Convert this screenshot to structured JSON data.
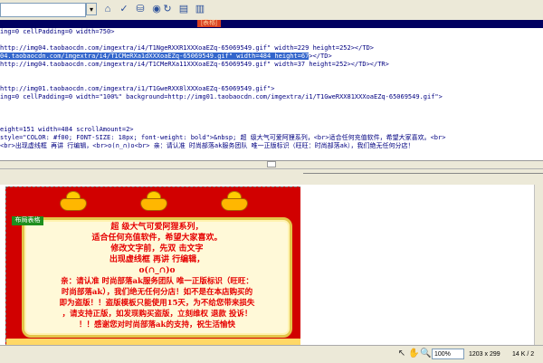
{
  "toolbar": {
    "icons": [
      "validate-icon",
      "check-icon",
      "browser-icon",
      "refresh-icon",
      "options-icon",
      "view-icon"
    ],
    "glyphs": [
      "⌂",
      "✓",
      "⛁",
      "◉",
      "↻",
      "▤",
      "▥"
    ]
  },
  "title_tab": "[表格]",
  "code_lines": [
    {
      "pre": "ing=0 cellPadding=0 width=750>",
      "hl": "",
      "post": ""
    },
    {
      "pre": "",
      "hl": "",
      "post": ""
    },
    {
      "pre": "http://img04.taobaocdn.com/imgextra/i4/T1NgeRXXR1XXXoaEZq-65069549.gif\" width=229 height=252></TD>",
      "hl": "",
      "post": ""
    },
    {
      "pre": "04.taobaocdn.com/imgextra/i4/T1CMeRXa1dXXXoaEZq-65069549.gif\" width=484 height=67",
      "hl": "></TD>",
      "post": ""
    },
    {
      "pre": "http://img04.taobaocdn.com/imgextra/i4/T1CMeRXa11XXXoaEZq-65069549.gif\" width=37 height=252></TD></TR>",
      "hl": "",
      "post": ""
    },
    {
      "pre": "",
      "hl": "",
      "post": ""
    },
    {
      "pre": "",
      "hl": "",
      "post": ""
    },
    {
      "pre": "http://img01.taobaocdn.com/imgextra/i1/T1GweRXX8lXXXoaEZq-65069549.gif\">",
      "hl": "",
      "post": ""
    },
    {
      "pre": "ing=0 cellPadding=0 width=\"100%\" background=http://img01.taobaocdn.com/imgextra/i1/T1GweRXX81XXXoaEZq-65069549.gif\">",
      "hl": "",
      "post": ""
    },
    {
      "pre": "",
      "hl": "",
      "post": ""
    },
    {
      "pre": "",
      "hl": "",
      "post": ""
    },
    {
      "pre": "",
      "hl": "",
      "post": ""
    },
    {
      "pre": "eight=151 width=484 scrollAmount=2>",
      "hl": "",
      "post": ""
    },
    {
      "pre": "style=\"COLOR: #f00; FONT-SIZE: 18px; font-weight: bold\">&nbsp; 超 级大气可爱阿狸系列，<br>适合任何充值软件，希望大家喜欢。<br>",
      "hl": "",
      "post": ""
    },
    {
      "pre": "<br>出现虚线框 再讲 行编辑，<br>o(∩_∩)o<br> 亲：请认准 时尚部落ak服务团队 唯一正版标识（旺旺：时尚部落ak），我们绝无任何分店！",
      "hl": "",
      "post": ""
    }
  ],
  "design": {
    "tag_label": "布局表格",
    "paragraphs": [
      "超 级大气可爱阿狸系列，",
      "适合任何充值软件，希望大家喜欢。",
      "修改文字前，先双 击文字",
      "出现虚线框 再讲 行编辑，",
      "o(∩_∩)o",
      "亲：请认准 时尚部落ak服务团队 唯一正版标识（旺旺：",
      "时尚部落ak），我们绝无任何分店！如不是在本店购买的",
      "即为盗版！！盗版模板只能使用15天，为不给您带来损失",
      "，请支持正版，如发现购买盗版，立刻维权 退款 投诉！",
      "！！感谢您对时尚部落ak的支持，祝生活愉快"
    ]
  },
  "status": {
    "zoom": "100%",
    "dimensions": "1203 x 299",
    "size": "14 K / 2"
  },
  "colors": {
    "banner_red": "#d10000",
    "text_red": "#e60000",
    "gold": "#ffb700",
    "title_bar": "#000060"
  }
}
